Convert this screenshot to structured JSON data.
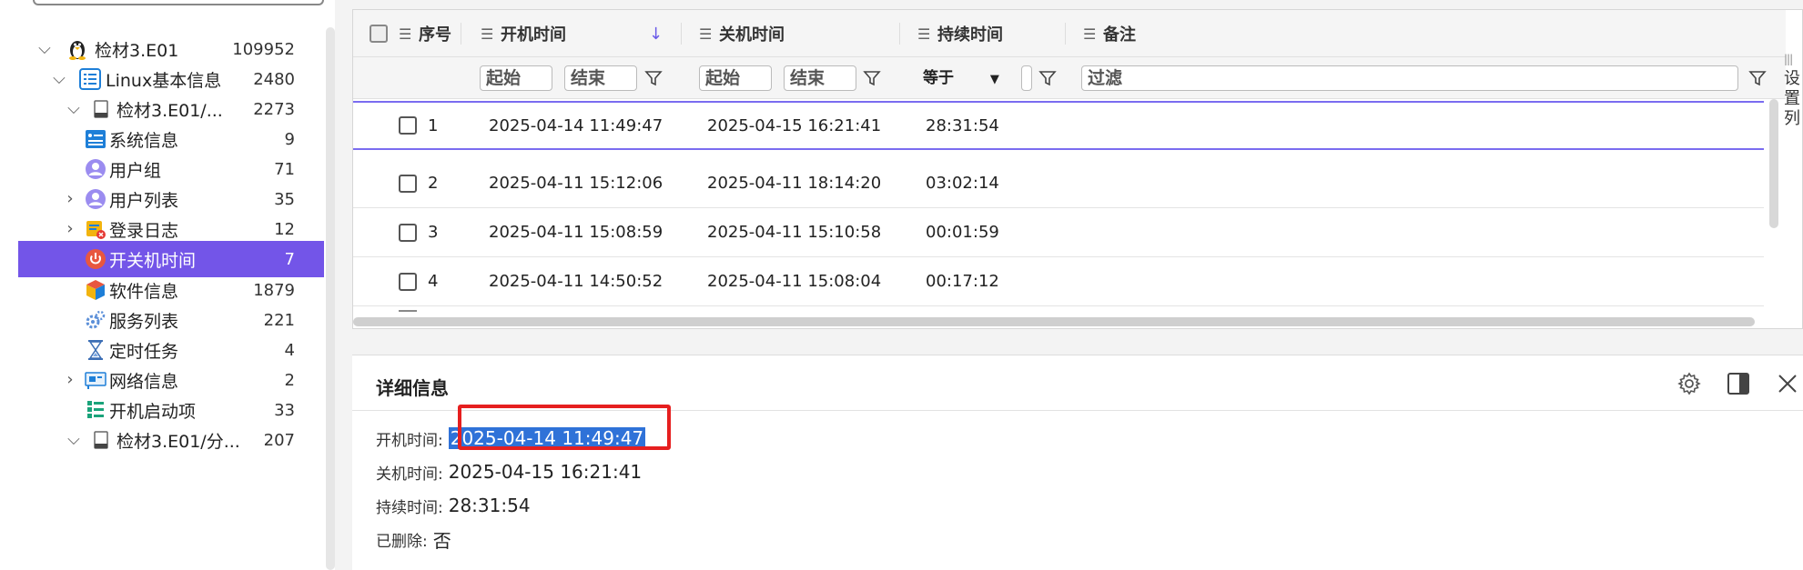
{
  "tree": {
    "items": [
      {
        "label": "检材3.E01",
        "count": "109952",
        "icon": "linux-tux-icon"
      },
      {
        "label": "Linux基本信息",
        "count": "2480",
        "icon": "list-icon"
      },
      {
        "label": "检材3.E01/...",
        "count": "2273",
        "icon": "disk-icon"
      },
      {
        "label": "系统信息",
        "count": "9",
        "icon": "system-info-icon"
      },
      {
        "label": "用户组",
        "count": "71",
        "icon": "user-icon"
      },
      {
        "label": "用户列表",
        "count": "35",
        "icon": "user-icon"
      },
      {
        "label": "登录日志",
        "count": "12",
        "icon": "login-log-icon"
      },
      {
        "label": "开关机时间",
        "count": "7",
        "icon": "power-icon"
      },
      {
        "label": "软件信息",
        "count": "1879",
        "icon": "cube-icon"
      },
      {
        "label": "服务列表",
        "count": "221",
        "icon": "gears-icon"
      },
      {
        "label": "定时任务",
        "count": "4",
        "icon": "hourglass-icon"
      },
      {
        "label": "网络信息",
        "count": "2",
        "icon": "network-card-icon"
      },
      {
        "label": "开机启动项",
        "count": "33",
        "icon": "startup-items-icon"
      },
      {
        "label": "检材3.E01/分...",
        "count": "207",
        "icon": "disk-icon"
      }
    ]
  },
  "table": {
    "columns": {
      "index": "序号",
      "start": "开机时间",
      "end": "关机时间",
      "duration": "持续时间",
      "note": "备注"
    },
    "filters": {
      "from": "起始",
      "to": "结束",
      "equals": "等于",
      "filter": "过滤"
    },
    "rows": [
      {
        "index": "1",
        "start": "2025-04-14 11:49:47",
        "end": "2025-04-15 16:21:41",
        "duration": "28:31:54"
      },
      {
        "index": "2",
        "start": "2025-04-11 15:12:06",
        "end": "2025-04-11 18:14:20",
        "duration": "03:02:14"
      },
      {
        "index": "3",
        "start": "2025-04-11 15:08:59",
        "end": "2025-04-11 15:10:58",
        "duration": "00:01:59"
      },
      {
        "index": "4",
        "start": "2025-04-11 14:50:52",
        "end": "2025-04-11 15:08:04",
        "duration": "00:17:12"
      }
    ]
  },
  "side_tab": {
    "label": "设置列"
  },
  "detail": {
    "title": "详细信息",
    "fields": [
      {
        "key": "开机时间:",
        "value": "2025-04-14 11:49:47"
      },
      {
        "key": "关机时间:",
        "value": "2025-04-15 16:21:41"
      },
      {
        "key": "持续时间:",
        "value": "28:31:54"
      },
      {
        "key": "已删除:",
        "value": "否"
      }
    ]
  },
  "colors": {
    "accent": "#7355e8",
    "selection": "#2f72d8",
    "highlight_box": "#e61f1f"
  }
}
